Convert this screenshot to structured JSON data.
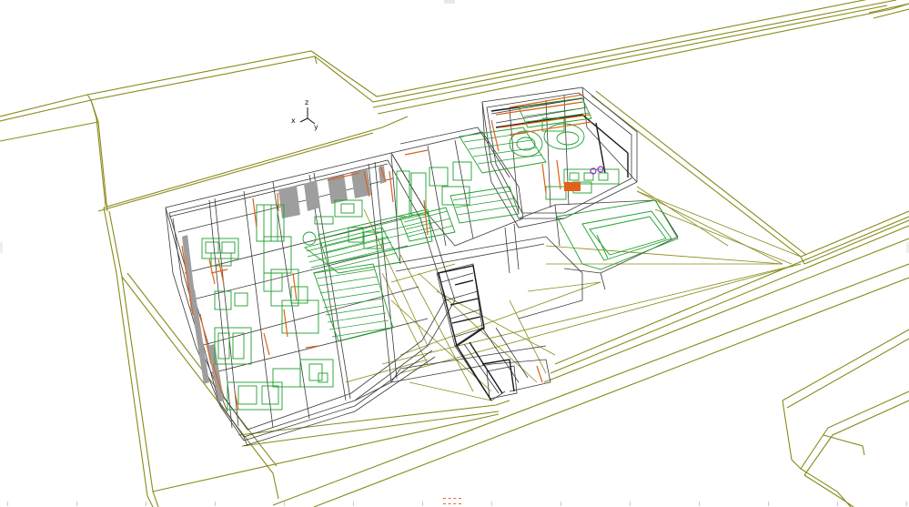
{
  "viewport": {
    "mode": "wireframe-3d",
    "axis_triad": {
      "x": "x",
      "y": "y",
      "z": "z"
    },
    "colors": {
      "background": "#ffffff",
      "site_lines": "#8a8a1a",
      "structure_lines": "#3a3a3a",
      "furniture_lines": "#1f9e2e",
      "doors_windows": "#e0621a",
      "accent": "#9b1ec9",
      "solid_panels": "#9e9e9e"
    }
  }
}
